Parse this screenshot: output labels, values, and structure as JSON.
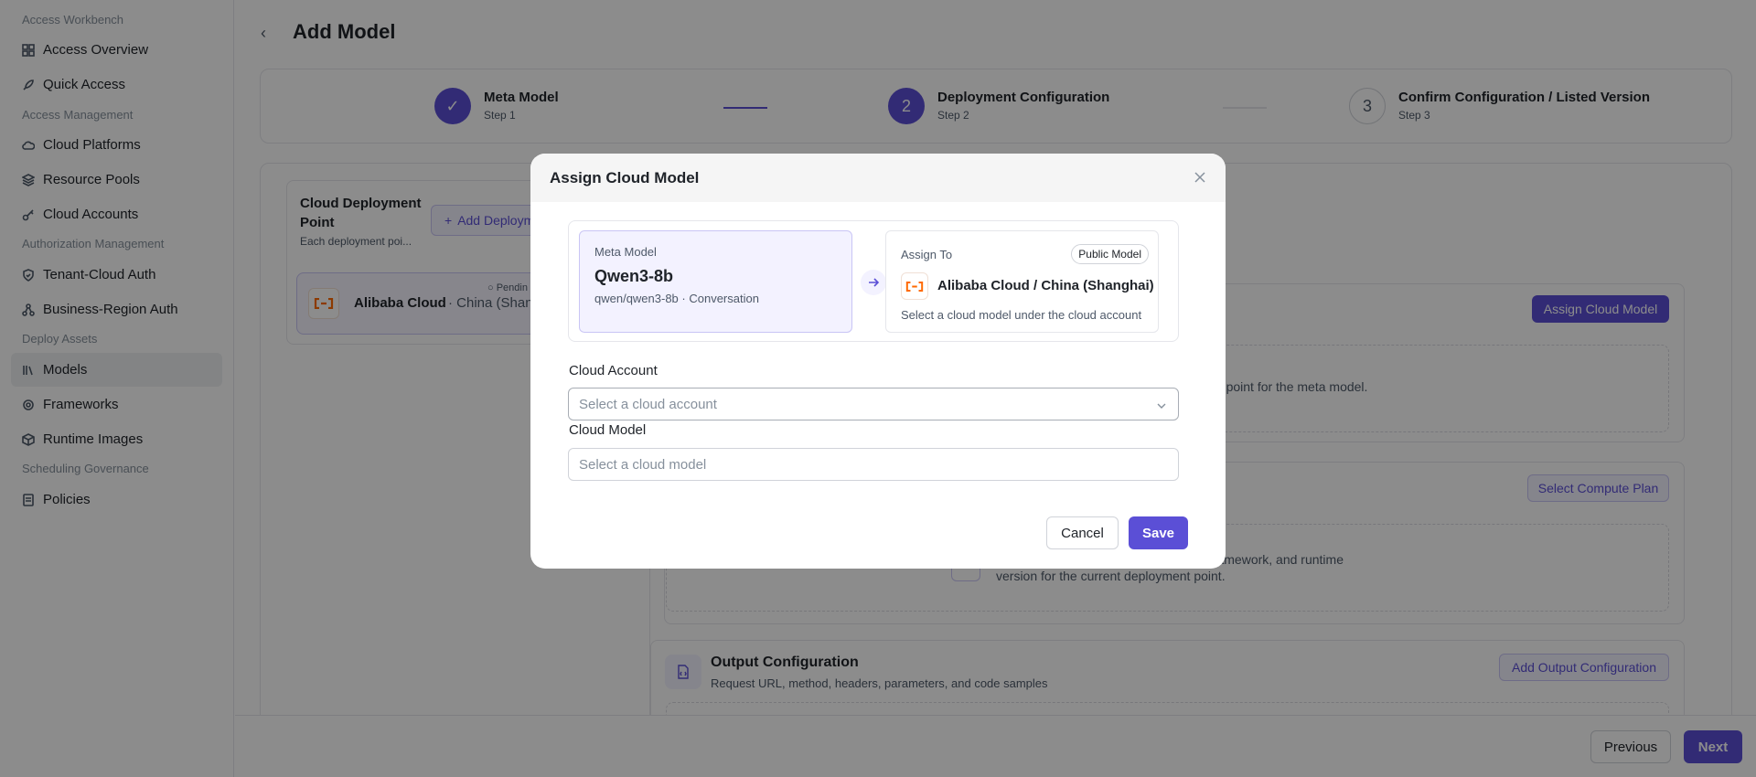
{
  "sidebar": {
    "sections": [
      {
        "label": "Access Workbench"
      },
      {
        "label": "Access Management"
      },
      {
        "label": "Authorization Management"
      },
      {
        "label": "Deploy Assets"
      },
      {
        "label": "Scheduling Governance"
      }
    ],
    "items": [
      {
        "label": "Access Overview",
        "icon": "grid-icon"
      },
      {
        "label": "Quick Access",
        "icon": "rocket-icon"
      },
      {
        "label": "Cloud Platforms",
        "icon": "cloud-icon"
      },
      {
        "label": "Resource Pools",
        "icon": "layers-icon"
      },
      {
        "label": "Cloud Accounts",
        "icon": "key-icon"
      },
      {
        "label": "Tenant-Cloud Auth",
        "icon": "shield-icon"
      },
      {
        "label": "Business-Region Auth",
        "icon": "network-icon"
      },
      {
        "label": "Models",
        "icon": "library-icon",
        "active": true
      },
      {
        "label": "Frameworks",
        "icon": "gear-icon"
      },
      {
        "label": "Runtime Images",
        "icon": "package-icon"
      },
      {
        "label": "Policies",
        "icon": "policy-icon"
      }
    ]
  },
  "page": {
    "title": "Add Model"
  },
  "steps": [
    {
      "title": "Meta Model",
      "sub": "Step 1",
      "marker": "✓",
      "state": "done"
    },
    {
      "title": "Deployment Configuration",
      "sub": "Step 2",
      "marker": "2",
      "state": "active"
    },
    {
      "title": "Confirm Configuration / Listed Version",
      "sub": "Step 3",
      "marker": "3",
      "state": "pending"
    }
  ],
  "left_panel": {
    "title": "Cloud Deployment Point",
    "subtitle": "Each deployment poi...",
    "add_button": "Add Deploym",
    "item": {
      "provider": "Alibaba Cloud",
      "region": " · China (Shangh",
      "status": "○ Pendin"
    }
  },
  "right_panel": {
    "assign_button": "Assign Cloud Model",
    "assign_hint": "nt point for the meta model.",
    "compute_button": "Select Compute Plan",
    "compute_hint_1": "amework, and runtime",
    "compute_hint_2": "version for the current deployment point.",
    "output_title": "Output Configuration",
    "output_sub": "Request URL, method, headers, parameters, and code samples",
    "output_button": "Add Output Configuration"
  },
  "footer": {
    "previous": "Previous",
    "next": "Next"
  },
  "modal": {
    "title": "Assign Cloud Model",
    "meta": {
      "label": "Meta Model",
      "name": "Qwen3-8b",
      "detail": "qwen/qwen3-8b · Conversation"
    },
    "target": {
      "label": "Assign To",
      "badge": "Public Model",
      "name": "Alibaba Cloud / China (Shanghai)",
      "hint": "Select a cloud model under the cloud account"
    },
    "cloud_account": {
      "label": "Cloud Account",
      "placeholder": "Select a cloud account"
    },
    "cloud_model": {
      "label": "Cloud Model",
      "placeholder": "Select a cloud model"
    },
    "cancel": "Cancel",
    "save": "Save"
  },
  "colors": {
    "accent": "#5b4fd6",
    "accent_light": "#f3f2ff",
    "alibaba": "#ff6a00"
  }
}
